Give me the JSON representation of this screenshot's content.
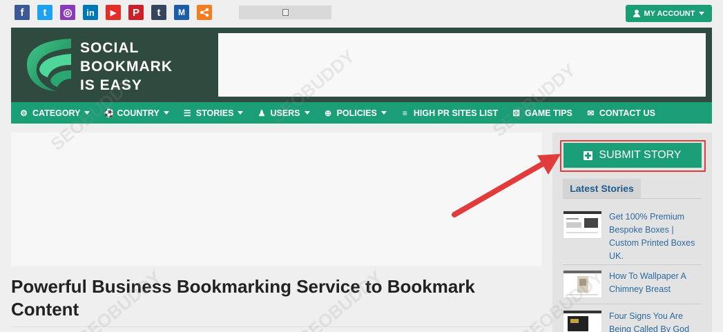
{
  "topbar": {
    "social_icons": [
      {
        "name": "facebook-icon",
        "glyph": "f",
        "color": "#3b5998"
      },
      {
        "name": "twitter-icon",
        "glyph": "t",
        "color": "#1da1f2"
      },
      {
        "name": "instagram-icon",
        "glyph": "◎",
        "color": "#8a3ab9"
      },
      {
        "name": "linkedin-icon",
        "glyph": "in",
        "color": "#0077b5"
      },
      {
        "name": "youtube-icon",
        "glyph": "▶",
        "color": "#e52d27"
      },
      {
        "name": "pinterest-icon",
        "glyph": "P",
        "color": "#cb2027"
      },
      {
        "name": "tumblr-icon",
        "glyph": "t",
        "color": "#35465c"
      },
      {
        "name": "medium-icon",
        "glyph": "M",
        "color": "#1a5ea8"
      },
      {
        "name": "share-icon",
        "glyph": "⋖",
        "color": "#f47d20"
      }
    ],
    "account_label": "MY ACCOUNT"
  },
  "header": {
    "logo_lines": [
      "SOCIAL",
      "BOOKMARK",
      "IS EASY"
    ]
  },
  "nav": {
    "items": [
      {
        "label": "CATEGORY",
        "icon": "⚙",
        "dropdown": true
      },
      {
        "label": "COUNTRY",
        "icon": "⚽",
        "dropdown": true
      },
      {
        "label": "STORIES",
        "icon": "☰",
        "dropdown": true
      },
      {
        "label": "USERS",
        "icon": "♟",
        "dropdown": true
      },
      {
        "label": "POLICIES",
        "icon": "⊕",
        "dropdown": true
      },
      {
        "label": "HIGH PR SITES LIST",
        "icon": "≡",
        "dropdown": false
      },
      {
        "label": "GAME TIPS",
        "icon": "⚄",
        "dropdown": false
      },
      {
        "label": "CONTACT US",
        "icon": "✉",
        "dropdown": false
      }
    ]
  },
  "main": {
    "title": "Powerful Business Bookmarking Service to Bookmark Content"
  },
  "sidebar": {
    "submit_label": "SUBMIT STORY",
    "latest_label": "Latest Stories",
    "stories": [
      {
        "title": "Get 100% Premium Bespoke Boxes | Custom Printed Boxes UK."
      },
      {
        "title": "How To Wallpaper A Chimney Breast"
      },
      {
        "title": "Four Signs You Are Being Called By God"
      }
    ]
  },
  "colors": {
    "accent": "#1a9e76",
    "header_bg": "#2f4a3f",
    "highlight": "#e23b3b",
    "link": "#2c6aa0"
  }
}
